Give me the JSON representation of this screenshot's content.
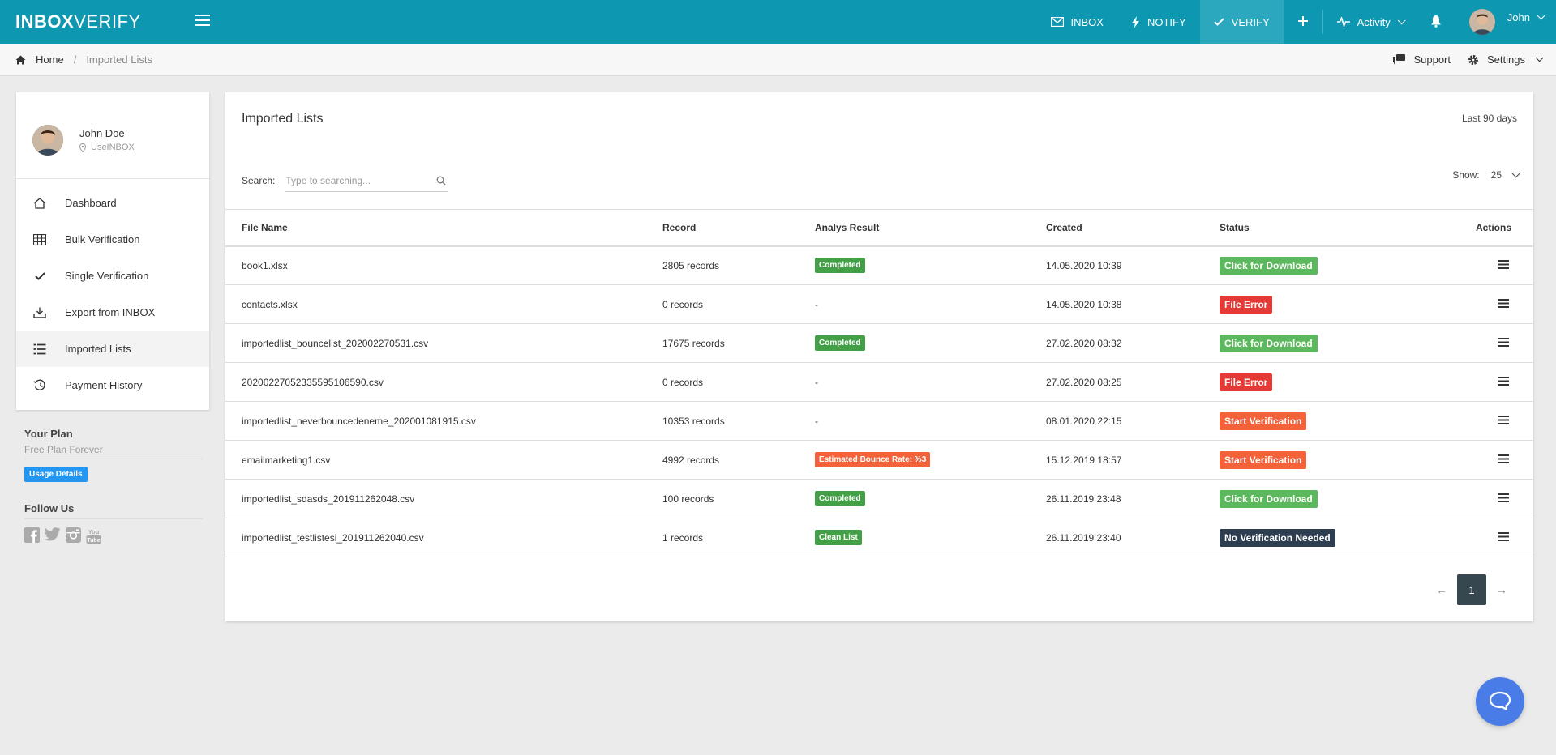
{
  "brand": {
    "part1": "INB",
    "part2": "O",
    "part3": "X",
    "part4": "VERIFY"
  },
  "topnav": {
    "inbox": "INBOX",
    "notify": "NOTIFY",
    "verify": "VERIFY",
    "activity": "Activity",
    "user": "John"
  },
  "breadcrumb": {
    "home": "Home",
    "separator": "/",
    "current": "Imported Lists"
  },
  "toolbar": {
    "support": "Support",
    "settings": "Settings"
  },
  "profile": {
    "name": "John Doe",
    "company": "UseINBOX"
  },
  "sidebar": {
    "items": [
      {
        "label": "Dashboard",
        "icon": "home-icon"
      },
      {
        "label": "Bulk Verification",
        "icon": "grid-icon"
      },
      {
        "label": "Single Verification",
        "icon": "check-icon"
      },
      {
        "label": "Export from INBOX",
        "icon": "export-icon"
      },
      {
        "label": "Imported Lists",
        "icon": "list-icon"
      },
      {
        "label": "Payment History",
        "icon": "history-icon"
      }
    ]
  },
  "plan": {
    "heading": "Your Plan",
    "name": "Free Plan Forever",
    "usage_button": "Usage Details"
  },
  "follow": {
    "heading": "Follow Us",
    "icons": [
      "facebook-icon",
      "twitter-icon",
      "instagram-icon",
      "youtube-icon"
    ]
  },
  "main": {
    "title": "Imported Lists",
    "range": "Last 90 days",
    "search_label": "Search:",
    "search_placeholder": "Type to searching...",
    "show_label": "Show:",
    "show_value": "25"
  },
  "table": {
    "headers": [
      "File Name",
      "Record",
      "Analys Result",
      "Created",
      "Status",
      "Actions"
    ],
    "rows": [
      {
        "file": "book1.xlsx",
        "records": "2805 records",
        "result": "Completed",
        "result_type": "green",
        "created": "14.05.2020 10:39",
        "status": "Click for Download",
        "status_type": "green"
      },
      {
        "file": "contacts.xlsx",
        "records": "0 records",
        "result": "-",
        "result_type": "none",
        "created": "14.05.2020 10:38",
        "status": "File Error",
        "status_type": "red"
      },
      {
        "file": "importedlist_bouncelist_202002270531.csv",
        "records": "17675 records",
        "result": "Completed",
        "result_type": "green",
        "created": "27.02.2020 08:32",
        "status": "Click for Download",
        "status_type": "green"
      },
      {
        "file": "20200227052335595106590.csv",
        "records": "0 records",
        "result": "-",
        "result_type": "none",
        "created": "27.02.2020 08:25",
        "status": "File Error",
        "status_type": "red"
      },
      {
        "file": "importedlist_neverbouncedeneme_202001081915.csv",
        "records": "10353 records",
        "result": "-",
        "result_type": "none",
        "created": "08.01.2020 22:15",
        "status": "Start Verification",
        "status_type": "orange"
      },
      {
        "file": "emailmarketing1.csv",
        "records": "4992 records",
        "result": "Estimated Bounce Rate: %3",
        "result_type": "orange",
        "created": "15.12.2019 18:57",
        "status": "Start Verification",
        "status_type": "orange"
      },
      {
        "file": "importedlist_sdasds_201911262048.csv",
        "records": "100 records",
        "result": "Completed",
        "result_type": "green",
        "created": "26.11.2019 23:48",
        "status": "Click for Download",
        "status_type": "green"
      },
      {
        "file": "importedlist_testlistesi_201911262040.csv",
        "records": "1 records",
        "result": "Clean List",
        "result_type": "green",
        "created": "26.11.2019 23:40",
        "status": "No Verification Needed",
        "status_type": "dark"
      }
    ]
  },
  "pagination": {
    "prev": "←",
    "page": "1",
    "next": "→"
  },
  "colors": {
    "header": "#0e97b0",
    "active_nav": "#2ba8be",
    "green": "#43a047",
    "red": "#e53935",
    "orange": "#f4623a",
    "dark": "#2c3e50",
    "chat": "#4a7ce8"
  }
}
